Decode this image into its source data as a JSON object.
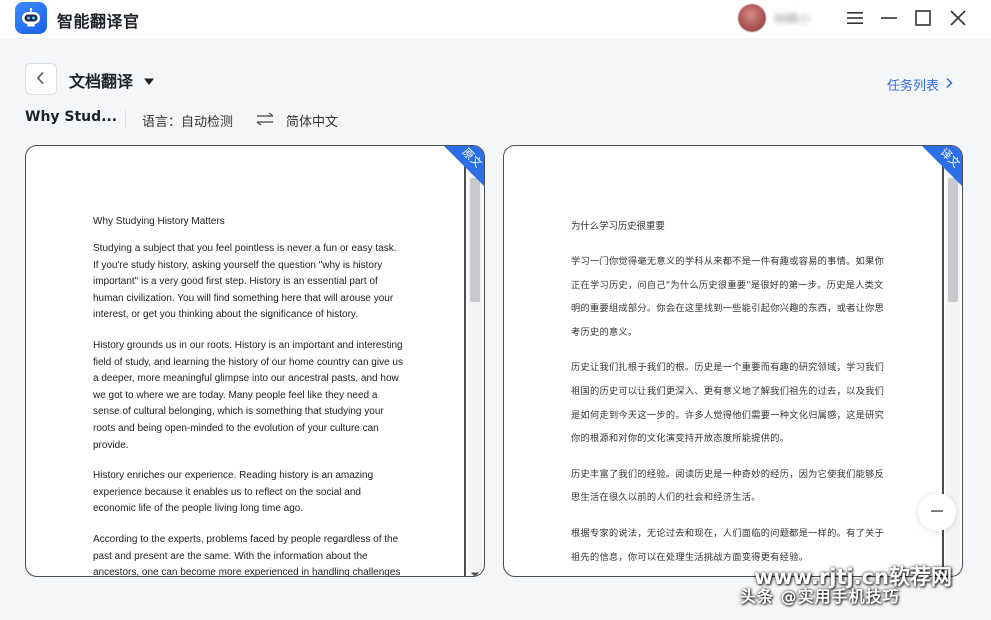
{
  "app": {
    "title": "智能翻译官",
    "username": "林鳞小"
  },
  "toolbar": {
    "page_title": "文档翻译",
    "task_list_label": "任务列表",
    "doc_name": "Why Stud...",
    "language_label": "语言：自动检测",
    "target_language": "简体中文"
  },
  "colors": {
    "accent": "#2f6bdc",
    "tag_blue": "#2b6fe6",
    "panel_border": "#4a4d52"
  },
  "source_panel": {
    "tag": "原文",
    "title": "Why Studying History Matters",
    "paragraphs": [
      "Studying a subject that you feel pointless is never a fun or easy task. If you're study history, asking yourself the question \"why is history important\" is a very good first step. History is an essential part of human civilization. You will find something here that will arouse your interest, or get you thinking about the significance of history.",
      "History grounds us in our roots. History is an important and interesting field of study, and learning the history of our home country can give us a deeper, more meaningful glimpse into our ancestral pasts, and how we got to where we are today. Many people feel like they need a sense of cultural belonging, which is something that studying your roots and being open-minded to the evolution of your culture can provide.",
      "History enriches our experience. Reading history is an amazing experience because it enables us to reflect on the social and economic life of the people living long time ago.",
      "According to the experts, problems faced by people regardless of the past and present are the same. With the information about the ancestors, one can become more experienced in handling challenges"
    ]
  },
  "target_panel": {
    "tag": "译文",
    "title": "为什么学习历史很重要",
    "paragraphs": [
      "学习一门你觉得毫无意义的学科从来都不是一件有趣或容易的事情。如果你正在学习历史，问自己\"为什么历史很重要\"是很好的第一步。历史是人类文明的重要组成部分。你会在这里找到一些能引起你兴趣的东西，或者让你思考历史的意义。",
      "历史让我们扎根于我们的根。历史是一个重要而有趣的研究领域，学习我们祖国的历史可以让我们更深入、更有意义地了解我们祖先的过去，以及我们是如何走到今天这一步的。许多人觉得他们需要一种文化归属感，这是研究你的根源和对你的文化演变持开放态度所能提供的。",
      "历史丰富了我们的经验。阅读历史是一种奇妙的经历，因为它使我们能够反思生活在很久以前的人们的社会和经济生活。",
      "根据专家的说法，无论过去和现在，人们面临的问题都是一样的。有了关于祖先的信息，你可以在处理生活挑战方面变得更有经验。"
    ]
  },
  "watermark": {
    "line1": "www.rjtj.cn软荐网",
    "line2": "头条 @实用手机技巧"
  },
  "icons": {
    "logo": "robot-logo-icon",
    "menu": "hamburger-menu-icon",
    "minimize": "minimize-icon",
    "maximize": "maximize-icon",
    "close": "close-icon",
    "back": "chevron-left-icon",
    "caret": "caret-down-icon",
    "task_arrow": "chevron-right-icon",
    "swap": "swap-arrows-icon",
    "zoom_out": "minus-icon"
  }
}
